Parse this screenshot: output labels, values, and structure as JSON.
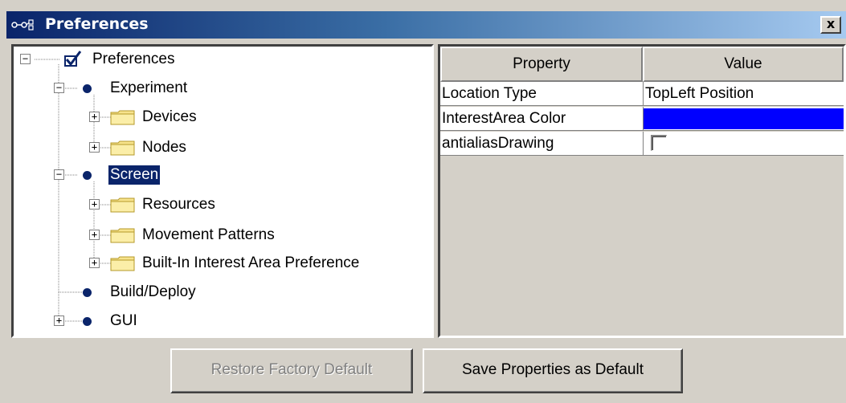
{
  "window": {
    "title": "Preferences",
    "close_label": "x"
  },
  "tree": {
    "root_label": "Preferences",
    "nodes": [
      {
        "label": "Experiment",
        "type": "dot",
        "expander": "−"
      },
      {
        "label": "Devices",
        "type": "folder",
        "expander": "+"
      },
      {
        "label": "Nodes",
        "type": "folder",
        "expander": "+"
      },
      {
        "label": "Screen",
        "type": "dot",
        "expander": "−",
        "selected": true
      },
      {
        "label": "Resources",
        "type": "folder",
        "expander": "+"
      },
      {
        "label": "Movement Patterns",
        "type": "folder",
        "expander": "+"
      },
      {
        "label": "Built-In Interest Area Preference",
        "type": "folder",
        "expander": "+"
      },
      {
        "label": "Build/Deploy",
        "type": "dot"
      },
      {
        "label": "GUI",
        "type": "dot",
        "expander": "+"
      }
    ],
    "root_expander": "−"
  },
  "properties": {
    "header_property": "Property",
    "header_value": "Value",
    "rows": [
      {
        "property": "Location Type",
        "value": "TopLeft Position"
      },
      {
        "property": "InterestArea Color",
        "value": "",
        "color": "#0000ff"
      },
      {
        "property": "antialiasDrawing",
        "value": "",
        "checked": false
      }
    ]
  },
  "buttons": {
    "restore_label": "Restore Factory Default",
    "save_label": "Save Properties as Default"
  },
  "colors": {
    "selection": "#0a246a",
    "title_start": "#0a246a",
    "swatch": "#0000ff"
  }
}
